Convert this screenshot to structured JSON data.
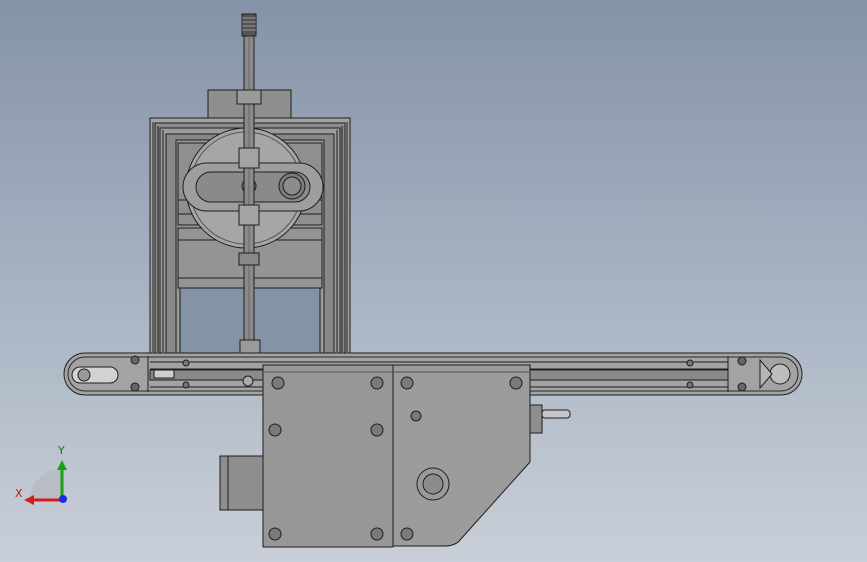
{
  "triad": {
    "x_label": "X",
    "y_label": "Y",
    "x_color": "#d01c1c",
    "y_color": "#18a018",
    "z_color": "#1c2ce0"
  },
  "colors": {
    "background_top": "#8593a7",
    "background_bottom": "#c9cfd8",
    "part_fill": "#9a9a9a",
    "part_dark": "#6f6f6f",
    "edge": "#1e1e1e"
  }
}
